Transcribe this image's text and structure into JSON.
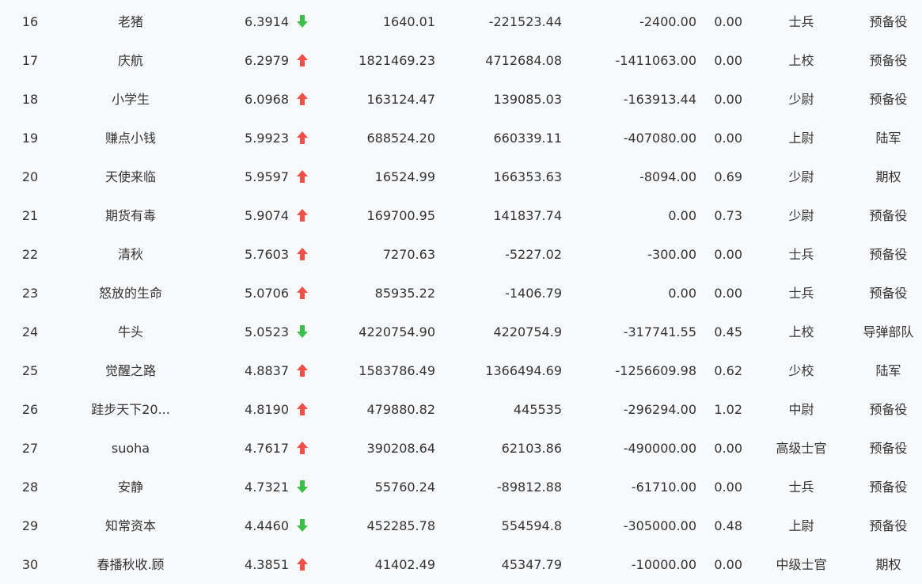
{
  "colors": {
    "up": "#f0504a",
    "down": "#3bbf4a",
    "text": "#333333",
    "background": "#f8f9fb"
  },
  "rows": [
    {
      "rank": "16",
      "name": "老猪",
      "score": "6.3914",
      "trend": "down",
      "a": "1640.01",
      "b": "-221523.44",
      "c": "-2400.00",
      "d": "0.00",
      "rank_name": "士兵",
      "type": "预备役"
    },
    {
      "rank": "17",
      "name": "庆航",
      "score": "6.2979",
      "trend": "up",
      "a": "1821469.23",
      "b": "4712684.08",
      "c": "-1411063.00",
      "d": "0.00",
      "rank_name": "上校",
      "type": "预备役"
    },
    {
      "rank": "18",
      "name": "小学生",
      "score": "6.0968",
      "trend": "up",
      "a": "163124.47",
      "b": "139085.03",
      "c": "-163913.44",
      "d": "0.00",
      "rank_name": "少尉",
      "type": "预备役"
    },
    {
      "rank": "19",
      "name": "赚点小钱",
      "score": "5.9923",
      "trend": "up",
      "a": "688524.20",
      "b": "660339.11",
      "c": "-407080.00",
      "d": "0.00",
      "rank_name": "上尉",
      "type": "陆军"
    },
    {
      "rank": "20",
      "name": "天使来临",
      "score": "5.9597",
      "trend": "up",
      "a": "16524.99",
      "b": "166353.63",
      "c": "-8094.00",
      "d": "0.69",
      "rank_name": "少尉",
      "type": "期权"
    },
    {
      "rank": "21",
      "name": "期货有毒",
      "score": "5.9074",
      "trend": "up",
      "a": "169700.95",
      "b": "141837.74",
      "c": "0.00",
      "d": "0.73",
      "rank_name": "少尉",
      "type": "预备役"
    },
    {
      "rank": "22",
      "name": "清秋",
      "score": "5.7603",
      "trend": "up",
      "a": "7270.63",
      "b": "-5227.02",
      "c": "-300.00",
      "d": "0.00",
      "rank_name": "士兵",
      "type": "预备役"
    },
    {
      "rank": "23",
      "name": "怒放的生命",
      "score": "5.0706",
      "trend": "up",
      "a": "85935.22",
      "b": "-1406.79",
      "c": "0.00",
      "d": "0.00",
      "rank_name": "士兵",
      "type": "预备役"
    },
    {
      "rank": "24",
      "name": "牛头",
      "score": "5.0523",
      "trend": "down",
      "a": "4220754.90",
      "b": "4220754.9",
      "c": "-317741.55",
      "d": "0.45",
      "rank_name": "上校",
      "type": "导弹部队"
    },
    {
      "rank": "25",
      "name": "觉醒之路",
      "score": "4.8837",
      "trend": "up",
      "a": "1583786.49",
      "b": "1366494.69",
      "c": "-1256609.98",
      "d": "0.62",
      "rank_name": "少校",
      "type": "陆军"
    },
    {
      "rank": "26",
      "name": "跬步天下20...",
      "score": "4.8190",
      "trend": "up",
      "a": "479880.82",
      "b": "445535",
      "c": "-296294.00",
      "d": "1.02",
      "rank_name": "中尉",
      "type": "预备役"
    },
    {
      "rank": "27",
      "name": "suoha",
      "score": "4.7617",
      "trend": "up",
      "a": "390208.64",
      "b": "62103.86",
      "c": "-490000.00",
      "d": "0.00",
      "rank_name": "高级士官",
      "type": "预备役"
    },
    {
      "rank": "28",
      "name": "安静",
      "score": "4.7321",
      "trend": "down",
      "a": "55760.24",
      "b": "-89812.88",
      "c": "-61710.00",
      "d": "0.00",
      "rank_name": "士兵",
      "type": "预备役"
    },
    {
      "rank": "29",
      "name": "知常资本",
      "score": "4.4460",
      "trend": "down",
      "a": "452285.78",
      "b": "554594.8",
      "c": "-305000.00",
      "d": "0.48",
      "rank_name": "上尉",
      "type": "预备役"
    },
    {
      "rank": "30",
      "name": "春播秋收.顾",
      "score": "4.3851",
      "trend": "up",
      "a": "41402.49",
      "b": "45347.79",
      "c": "-10000.00",
      "d": "0.00",
      "rank_name": "中级士官",
      "type": "期权"
    }
  ]
}
